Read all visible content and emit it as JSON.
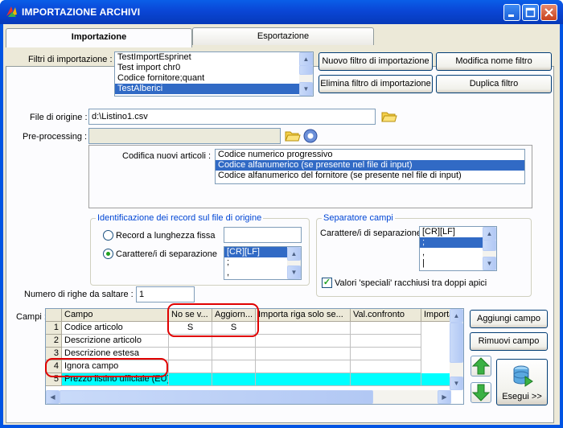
{
  "window": {
    "title": "IMPORTAZIONE ARCHIVI"
  },
  "tabs": [
    {
      "label": "Importazione"
    },
    {
      "label": "Esportazione"
    }
  ],
  "filters": {
    "label": "Filtri di importazione :",
    "items": [
      "TestImportEsprinet",
      "Test import chr0",
      "Codice fornitore;quant",
      "TestAlberici"
    ],
    "selected_index": 3,
    "new_button": "Nuovo filtro di importazione",
    "delete_button": "Elimina filtro di importazione",
    "rename_button": "Modifica nome filtro",
    "duplicate_button": "Duplica filtro"
  },
  "source_file": {
    "label": "File di origine :",
    "value": "d:\\Listino1.csv"
  },
  "preprocessing": {
    "label": "Pre-processing :",
    "value": ""
  },
  "encoding": {
    "label": "Codifica nuovi articoli :",
    "items": [
      "Codice numerico progressivo",
      "Codice alfanumerico (se presente nel file di input)",
      "Codice alfanumerico del fornitore (se presente nel file di input)"
    ],
    "selected_index": 1
  },
  "record_id": {
    "title": "Identificazione dei record sul file di origine",
    "fixed_length_label": "Record a lunghezza fissa",
    "separator_label": "Carattere/i di separazione",
    "fixed_value": "",
    "separator_items": [
      "[CR][LF]",
      ";",
      ","
    ]
  },
  "field_separator": {
    "title": "Separatore campi",
    "label": "Carattere/i di separazione",
    "items": [
      "[CR][LF]",
      ";",
      ",",
      "|"
    ],
    "selected_index": 1,
    "special_values_label": "Valori 'speciali' racchiusi tra doppi apici",
    "special_values_checked": true
  },
  "skip_rows": {
    "label": "Numero di righe da saltare :",
    "value": "1"
  },
  "fields": {
    "label": "Campi :",
    "columns": [
      "Campo",
      "No se v...",
      "Aggiorn...",
      "Importa riga solo se...",
      "Val.confronto",
      "Importa"
    ],
    "rows": [
      {
        "num": "1",
        "campo": "Codice articolo",
        "c1": "S",
        "c2": "S"
      },
      {
        "num": "2",
        "campo": "Descrizione articolo",
        "c1": "",
        "c2": ""
      },
      {
        "num": "3",
        "campo": "Descrizione estesa",
        "c1": "",
        "c2": ""
      },
      {
        "num": "4",
        "campo": "Ignora campo",
        "c1": "",
        "c2": ""
      },
      {
        "num": "5",
        "campo": "Prezzo listino ufficiale (EU)",
        "c1": "",
        "c2": ""
      }
    ],
    "add_button": "Aggiungi campo",
    "remove_button": "Rimuovi campo",
    "run_button": "Esegui >>"
  },
  "colors": {
    "titlebar": "#0a46d6",
    "highlight_row": "#00ffff",
    "selection": "#316ac5",
    "annotation": "#e00000"
  }
}
